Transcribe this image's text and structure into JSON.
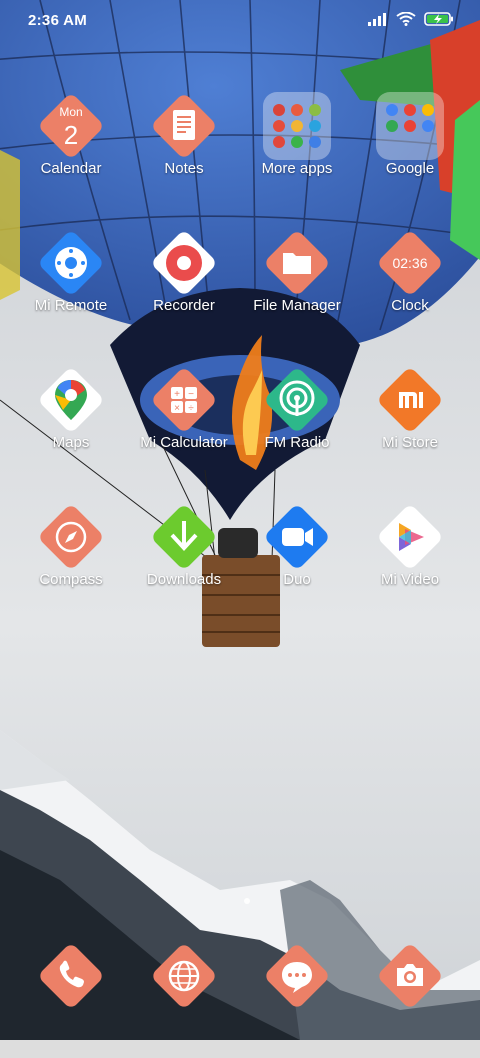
{
  "status_bar": {
    "time": "2:36 AM"
  },
  "apps": [
    {
      "id": "calendar",
      "label": "Calendar",
      "day": "Mon",
      "date": "2"
    },
    {
      "id": "notes",
      "label": "Notes"
    },
    {
      "id": "more-apps",
      "label": "More apps"
    },
    {
      "id": "google",
      "label": "Google"
    },
    {
      "id": "mi-remote",
      "label": "Mi Remote"
    },
    {
      "id": "recorder",
      "label": "Recorder"
    },
    {
      "id": "file-manager",
      "label": "File Manager"
    },
    {
      "id": "clock",
      "label": "Clock",
      "time": "02:36"
    },
    {
      "id": "maps",
      "label": "Maps"
    },
    {
      "id": "mi-calculator",
      "label": "Mi Calculator"
    },
    {
      "id": "fm-radio",
      "label": "FM Radio"
    },
    {
      "id": "mi-store",
      "label": "Mi Store",
      "logo": "mi"
    },
    {
      "id": "compass",
      "label": "Compass"
    },
    {
      "id": "downloads",
      "label": "Downloads"
    },
    {
      "id": "duo",
      "label": "Duo"
    },
    {
      "id": "mi-video",
      "label": "Mi Video"
    }
  ],
  "dock": [
    {
      "id": "phone",
      "icon": "phone-icon"
    },
    {
      "id": "browser",
      "icon": "globe-icon"
    },
    {
      "id": "messaging",
      "icon": "message-icon"
    },
    {
      "id": "camera",
      "icon": "camera-icon"
    }
  ],
  "colors": {
    "tile_coral": "#EC8067",
    "tile_blue": "#1E7BF0",
    "tile_green": "#2DB88A",
    "tile_orange": "#F27828",
    "tile_white": "#FFFFFF",
    "downloads_green": "#6CCB2E"
  }
}
